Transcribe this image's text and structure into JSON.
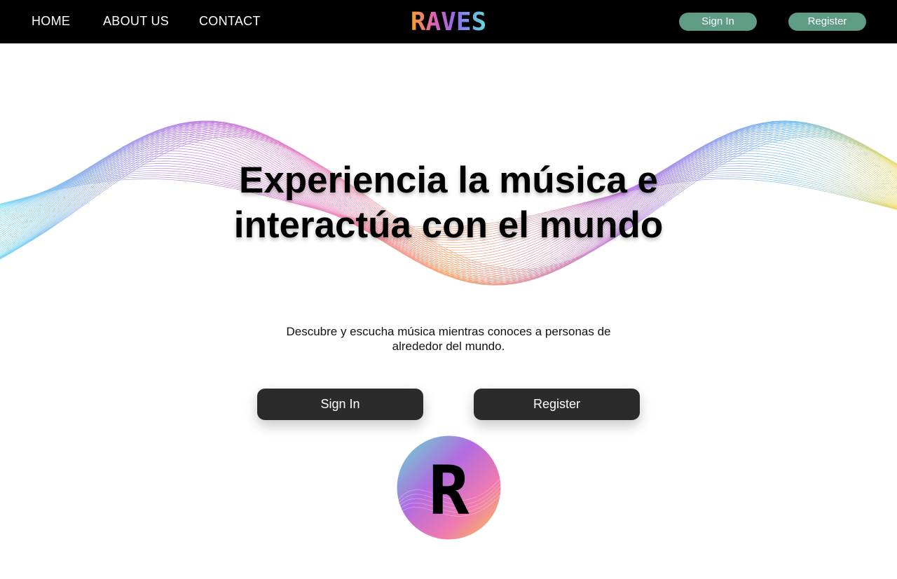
{
  "nav": {
    "links": [
      "HOME",
      "ABOUT US",
      "CONTACT"
    ],
    "brand": "RAVES",
    "sign_in": "Sign In",
    "register": "Register"
  },
  "hero": {
    "title_line1": "Experiencia la música e",
    "title_line2": "interactúa con el mundo",
    "subtitle_line1": "Descubre y escucha música mientras conoces a personas de",
    "subtitle_line2": "alrededor del mundo.",
    "sign_in": "Sign In",
    "register": "Register",
    "emblem_letter": "R"
  },
  "colors": {
    "topbar": "#000000",
    "nav_pill": "#5e9c86",
    "cta": "#2b2b2b",
    "wave": [
      "#5fd3f0",
      "#b36be0",
      "#f07ab0",
      "#f59a5a",
      "#e9d44a"
    ]
  },
  "icons": [
    "raves-logo",
    "wave-graphic",
    "raves-emblem"
  ]
}
